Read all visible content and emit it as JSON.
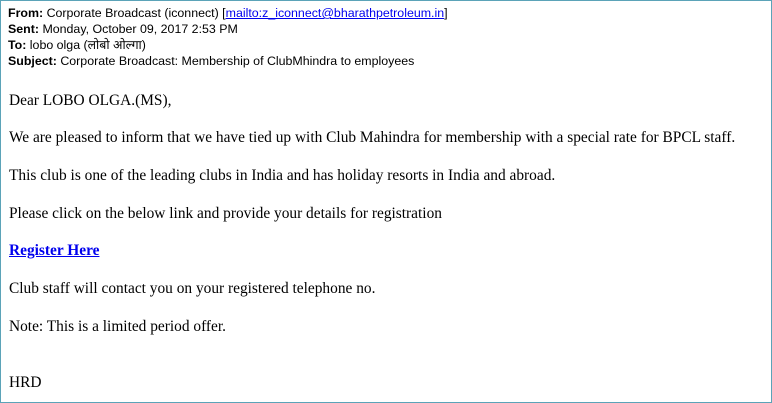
{
  "header": {
    "from_label": "From:",
    "from_value": "Corporate Broadcast (iconnect) [",
    "from_link": "mailto:z_iconnect@bharathpetroleum.in",
    "from_close": "]",
    "sent_label": "Sent:",
    "sent_value": "Monday, October 09, 2017 2:53 PM",
    "to_label": "To:",
    "to_value": "lobo olga (लोबो ओल्गा)",
    "subject_label": "Subject:",
    "subject_value": "Corporate Broadcast: Membership of ClubMhindra to employees"
  },
  "body": {
    "greeting": "Dear LOBO OLGA.(MS),",
    "para1": "We are pleased to inform that we have tied up with Club Mahindra for membership with a special rate for BPCL staff.",
    "para2": "This club is one of the leading clubs in India and has holiday resorts in India and abroad.",
    "para3": "Please click on the below link and provide your details for registration",
    "register_link": "Register Here",
    "para4": "Club staff will contact you on your registered telephone no.",
    "note": "Note: This is a limited period offer.",
    "signature": "HRD"
  },
  "colors": {
    "link": "#0000ee",
    "frame_border": "#5ba3b8"
  }
}
